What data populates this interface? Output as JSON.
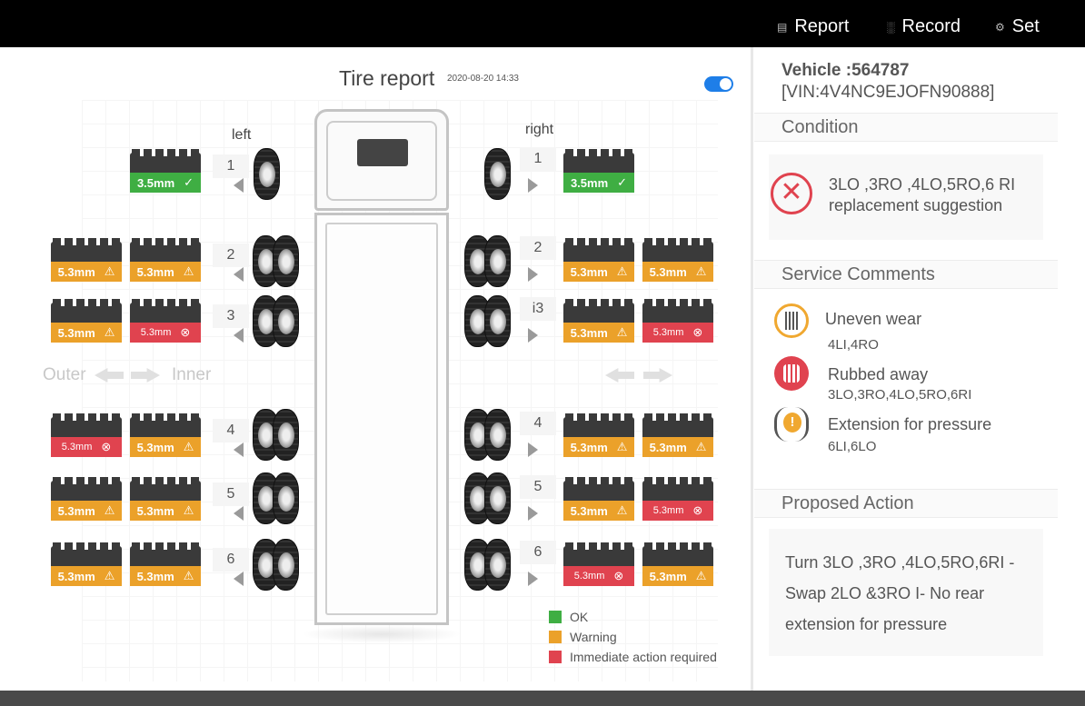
{
  "nav": {
    "report": "Report",
    "record": "Record",
    "set": "Set"
  },
  "report": {
    "title": "Tire report",
    "date": "2020-08-20 14:33",
    "left_label": "left",
    "right_label": "right",
    "outer_label": "Outer",
    "inner_label": "Inner",
    "axles": [
      {
        "num": "1",
        "left": [
          {
            "v": "3.5mm",
            "s": "ok"
          }
        ],
        "right": [
          {
            "v": "3.5mm",
            "s": "ok"
          }
        ]
      },
      {
        "num": "2",
        "left": [
          {
            "v": "5.3mm",
            "s": "warn"
          },
          {
            "v": "5.3mm",
            "s": "warn"
          }
        ],
        "right": [
          {
            "v": "5.3mm",
            "s": "warn"
          },
          {
            "v": "5.3mm",
            "s": "warn"
          }
        ]
      },
      {
        "num": "3",
        "right_num": "i3",
        "left": [
          {
            "v": "5.3mm",
            "s": "warn"
          },
          {
            "v": "5.3mm",
            "s": "crit"
          }
        ],
        "right": [
          {
            "v": "5.3mm",
            "s": "warn"
          },
          {
            "v": "5.3mm",
            "s": "crit"
          }
        ]
      },
      {
        "num": "4",
        "left": [
          {
            "v": "5.3mm",
            "s": "crit"
          },
          {
            "v": "5.3mm",
            "s": "warn"
          }
        ],
        "right": [
          {
            "v": "5.3mm",
            "s": "warn"
          },
          {
            "v": "5.3mm",
            "s": "warn"
          }
        ]
      },
      {
        "num": "5",
        "left": [
          {
            "v": "5.3mm",
            "s": "warn"
          },
          {
            "v": "5.3mm",
            "s": "warn"
          }
        ],
        "right": [
          {
            "v": "5.3mm",
            "s": "warn"
          },
          {
            "v": "5.3mm",
            "s": "crit"
          }
        ]
      },
      {
        "num": "6",
        "left": [
          {
            "v": "5.3mm",
            "s": "warn"
          },
          {
            "v": "5.3mm",
            "s": "warn"
          }
        ],
        "right": [
          {
            "v": "5.3mm",
            "s": "crit"
          },
          {
            "v": "5.3mm",
            "s": "warn"
          }
        ]
      }
    ],
    "legend": {
      "ok": "OK",
      "warning": "Warning",
      "critical": "Immediate action required"
    },
    "colors": {
      "ok": "#3fae43",
      "warning": "#eba12a",
      "critical": "#e0434f",
      "toggle": "#1e7ee8"
    }
  },
  "panel": {
    "vehicle": "Vehicle :564787",
    "vin": "[VIN:4V4NC9EJOFN90888]",
    "condition_head": "Condition",
    "condition_text": "3LO ,3RO ,4LO,5RO,6 RI replacement suggestion",
    "service_head": "Service Comments",
    "services": [
      {
        "icon": "uneven-wear-icon",
        "title": "Uneven wear",
        "sub": "4LI,4RO"
      },
      {
        "icon": "rubbed-away-icon",
        "title": "Rubbed away",
        "sub": "3LO,3RO,4LO,5RO,6RI"
      },
      {
        "icon": "pressure-warning-icon",
        "title": "Extension for pressure",
        "sub": "6LI,6LO"
      }
    ],
    "proposed_head": "Proposed Action",
    "proposed_lines": [
      "Turn 3LO ,3RO ,4LO,5RO,6RI -",
      "Swap 2LO &3RO I- No rear",
      "extension for pressure"
    ]
  }
}
